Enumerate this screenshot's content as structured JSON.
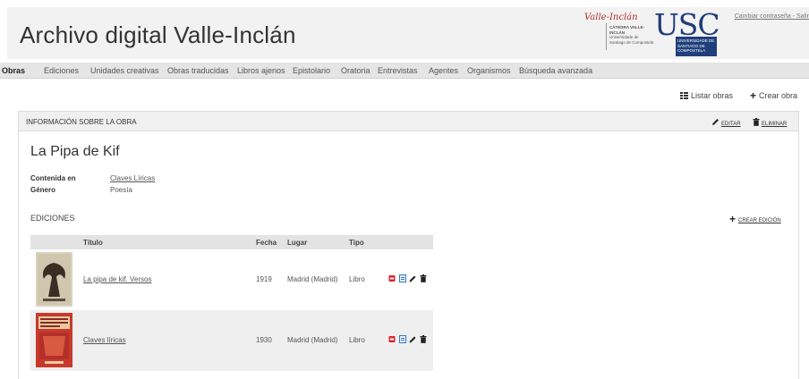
{
  "header": {
    "site_title": "Archivo digital Valle-Inclán",
    "catedra_signature": "Valle-Inclán",
    "catedra_text": "CÁTEDRA VALLE-INCLÁN",
    "catedra_subtext": "Universidade de Santiago de Compostela",
    "usc_letters": "USC",
    "usc_box_text": "UNIVERSIDADE DE SANTIAGO DE COMPOSTELA",
    "account_links": "Cambiar contraseña - Salir"
  },
  "nav": {
    "items": [
      "Obras",
      "Ediciones",
      "Unidades creativas",
      "Obras traducidas",
      "Libros ajenos",
      "Epistolario",
      "Oratoria",
      "Entrevistas",
      "Agentes",
      "Organismos",
      "Búsqueda avanzada"
    ],
    "active": "Obras"
  },
  "toolbar": {
    "list_label": "Listar obras",
    "create_label": "Crear obra"
  },
  "panel": {
    "title": "INFORMACIÓN SOBRE LA OBRA",
    "edit_label": "EDITAR",
    "delete_label": "ELIMINAR",
    "work_title": "La Pipa de Kif",
    "meta": [
      {
        "label": "Contenida en",
        "value": "Claves Líricas"
      },
      {
        "label": "Género",
        "value": "Poesía"
      }
    ],
    "editions_heading": "EDICIONES",
    "create_edition_label": "CREAR EDICIÓN"
  },
  "editions": {
    "headers": [
      "Título",
      "Fecha",
      "Lugar",
      "Tipo"
    ],
    "rows": [
      {
        "title": "La pipa de kif. Versos",
        "date": "1919",
        "place": "Madrid (Madrid)",
        "type": "Libro"
      },
      {
        "title": "Claves líricas",
        "date": "1930",
        "place": "Madrid (Madrid)",
        "type": "Libro"
      }
    ]
  },
  "colors": {
    "usc_blue": "#1f3e7a",
    "header_bg": "#f2f2f2",
    "nav_bg": "#e5e5e5",
    "pdf_red": "#d9262e",
    "doc_blue": "#3b78c2"
  },
  "icons": [
    "grid-icon",
    "plus-icon",
    "pencil-icon",
    "trash-icon",
    "pdf-icon",
    "document-icon"
  ]
}
